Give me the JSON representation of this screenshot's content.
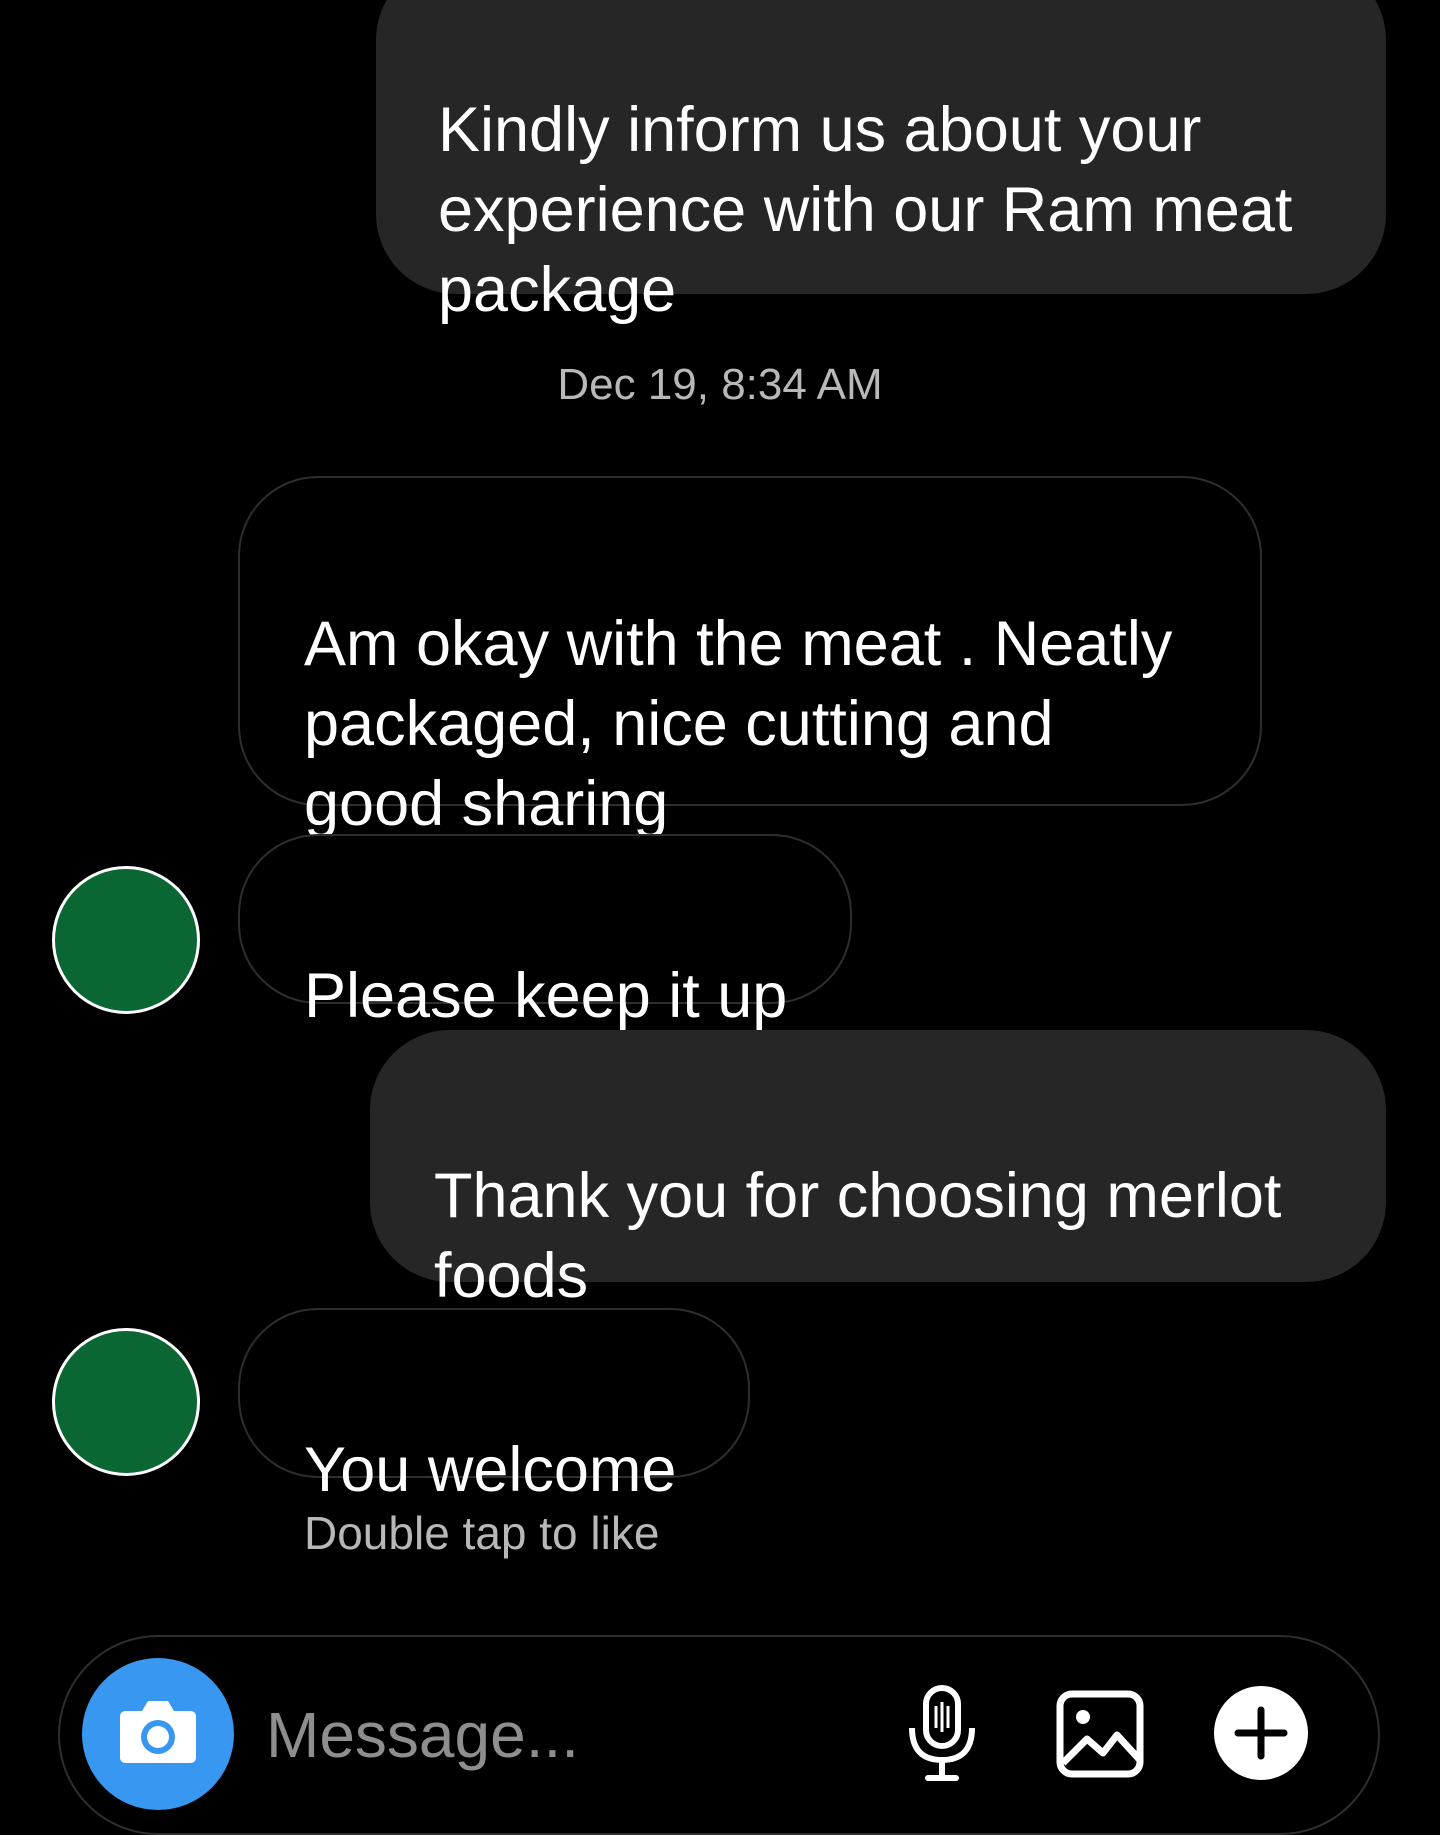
{
  "messages": [
    {
      "id": "m1",
      "direction": "outgoing",
      "text": "Kindly inform us about your\nexperience with our Ram meat\npackage"
    },
    {
      "id": "m2",
      "direction": "incoming",
      "text": "Am okay with the meat . Neatly\npackaged, nice cutting and\ngood sharing"
    },
    {
      "id": "m3",
      "direction": "incoming",
      "text": "Please keep it up"
    },
    {
      "id": "m4",
      "direction": "outgoing",
      "text": "Thank you for choosing merlot\nfoods"
    },
    {
      "id": "m5",
      "direction": "incoming",
      "text": "You welcome"
    }
  ],
  "timestamp": "Dec 19, 8:34 AM",
  "hint": "Double tap to like",
  "composer": {
    "placeholder": "Message...",
    "camera_icon": "camera-icon",
    "mic_icon": "microphone-icon",
    "gallery_icon": "gallery-icon",
    "plus_icon": "plus-circle-icon"
  },
  "colors": {
    "background": "#000000",
    "outgoing_bubble": "#262626",
    "incoming_border": "#2e2e2e",
    "avatar": "#0a6632",
    "camera_button": "#3897f0",
    "muted_text": "#b8b8b8"
  }
}
